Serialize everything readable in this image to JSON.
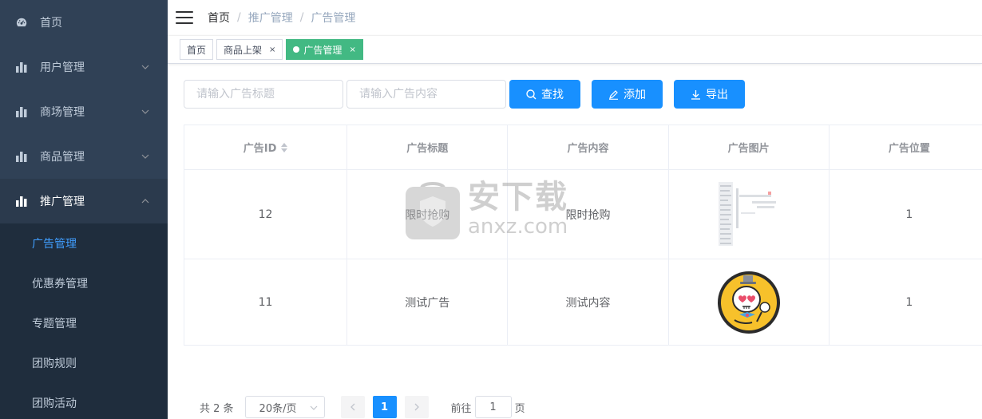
{
  "sidebar": {
    "items": [
      {
        "label": "首页",
        "icon": "dashboard-icon",
        "expandable": false
      },
      {
        "label": "用户管理",
        "icon": "bar-chart-icon",
        "expandable": true
      },
      {
        "label": "商场管理",
        "icon": "bar-chart-icon",
        "expandable": true
      },
      {
        "label": "商品管理",
        "icon": "bar-chart-icon",
        "expandable": true
      },
      {
        "label": "推广管理",
        "icon": "bar-chart-icon",
        "expandable": true,
        "open": true
      }
    ],
    "submenu": [
      {
        "label": "广告管理",
        "active": true
      },
      {
        "label": "优惠券管理"
      },
      {
        "label": "专题管理"
      },
      {
        "label": "团购规则"
      },
      {
        "label": "团购活动"
      }
    ]
  },
  "header": {
    "breadcrumb": [
      "首页",
      "推广管理",
      "广告管理"
    ],
    "separator": "/"
  },
  "tags": [
    {
      "label": "首页",
      "closable": false
    },
    {
      "label": "商品上架",
      "closable": true,
      "close": "×"
    },
    {
      "label": "广告管理",
      "closable": true,
      "active": true,
      "close": "×"
    }
  ],
  "filter": {
    "title_placeholder": "请输入广告标题",
    "content_placeholder": "请输入广告内容",
    "search_label": "查找",
    "add_label": "添加",
    "export_label": "导出"
  },
  "table": {
    "headers": [
      "广告ID",
      "广告标题",
      "广告内容",
      "广告图片",
      "广告位置"
    ],
    "rows": [
      {
        "id": "12",
        "title": "限时抢购",
        "content": "限时抢购",
        "image": "blurred-thumbnail",
        "position": "1"
      },
      {
        "id": "11",
        "title": "测试广告",
        "content": "测试内容",
        "image": "skull-avatar",
        "position": "1"
      }
    ]
  },
  "watermark": {
    "text_cn": "安下载",
    "text_en": "anxz.com"
  },
  "pagination": {
    "total_text": "共 2 条",
    "page_size": "20条/页",
    "current_page": "1",
    "goto_prefix": "前往",
    "goto_value": "1",
    "goto_suffix": "页"
  },
  "colors": {
    "sidebar_bg": "#304156",
    "submenu_bg": "#1f2d3d",
    "active_blue": "#409eff",
    "button_blue": "#1890ff",
    "tag_green": "#42b983"
  }
}
